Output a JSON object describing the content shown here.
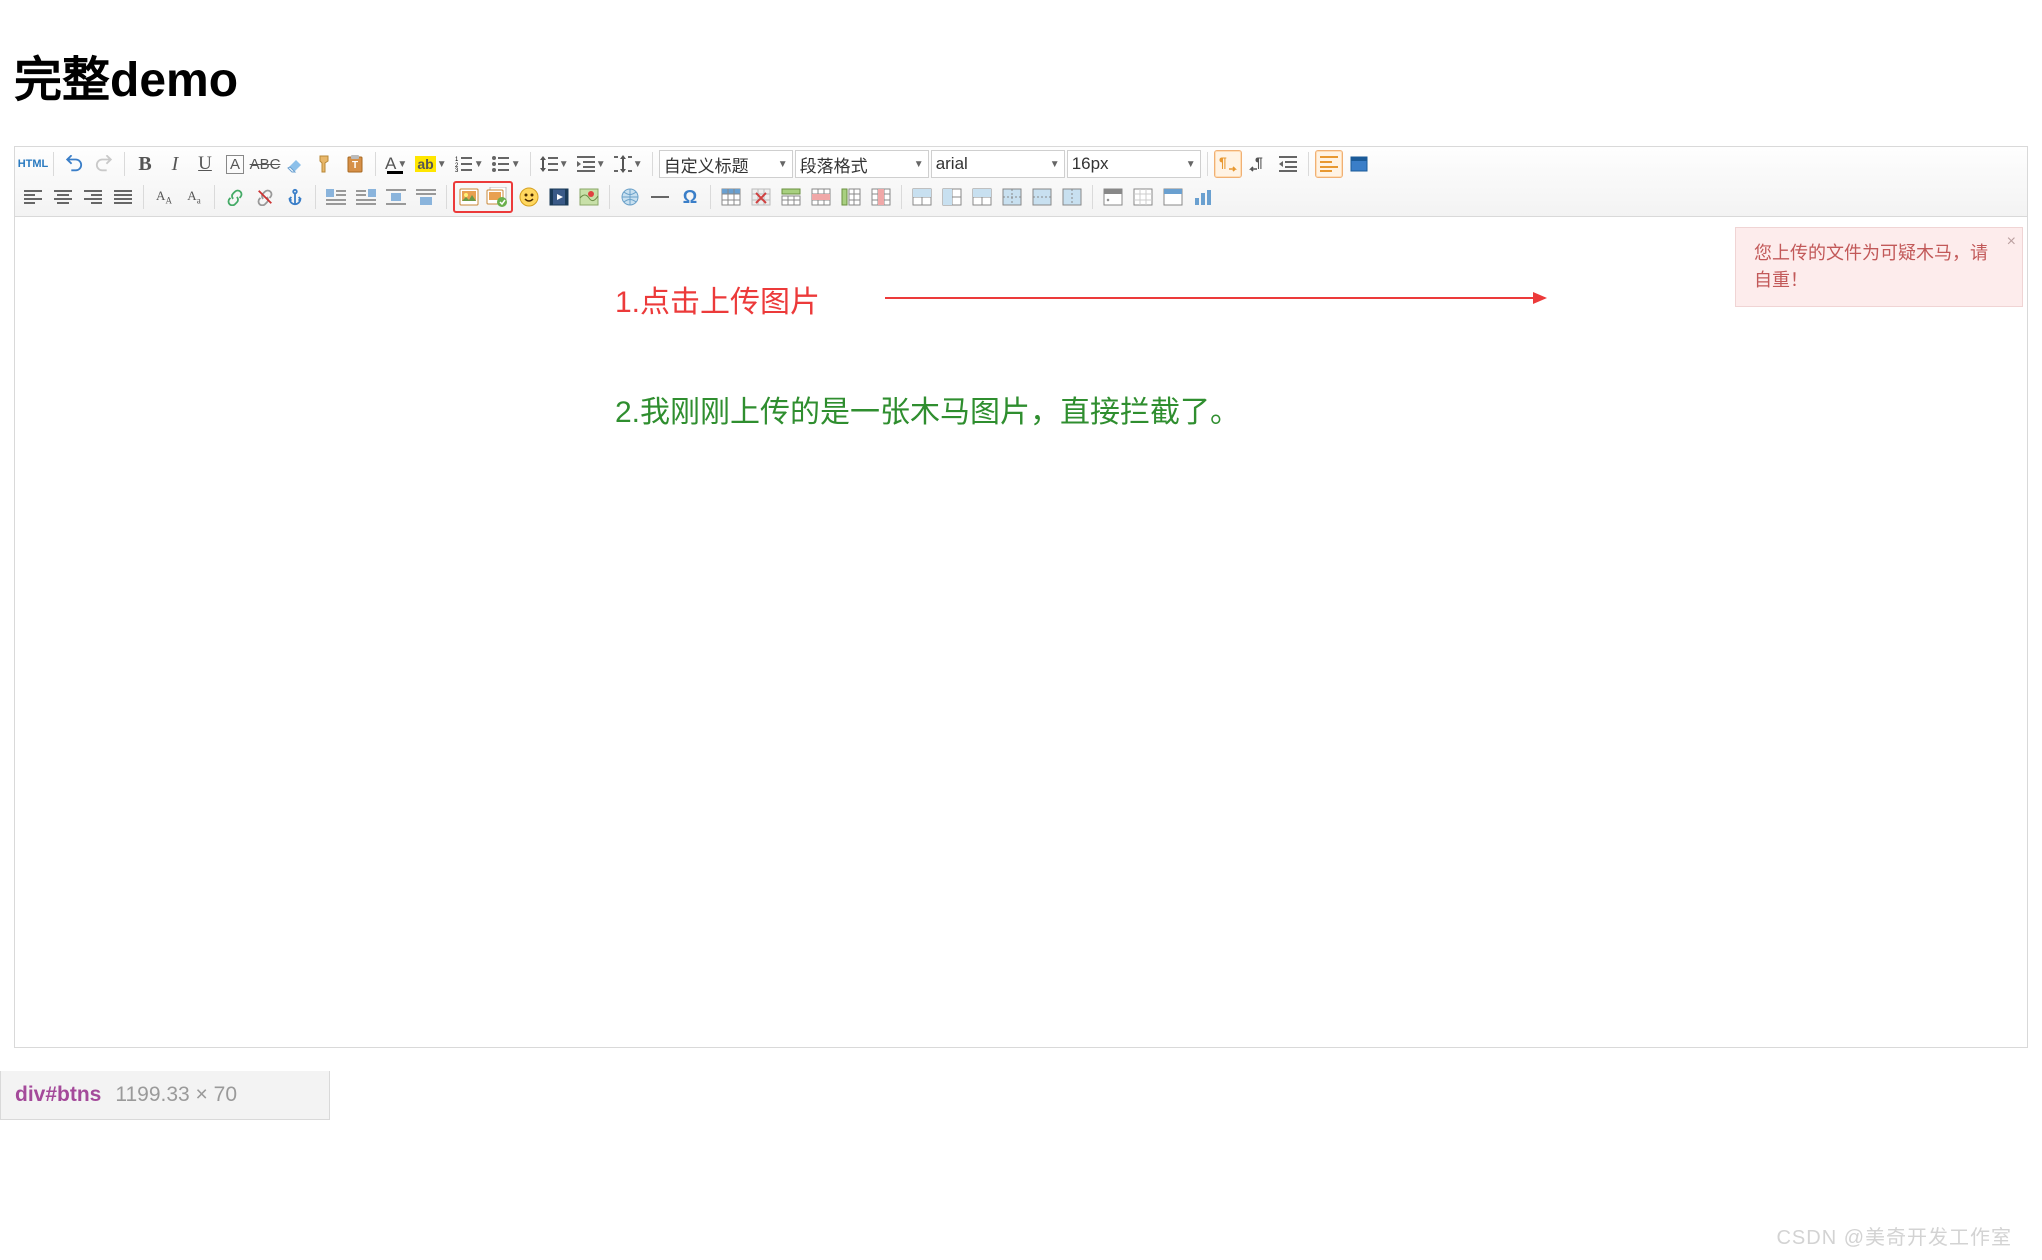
{
  "title": "完整demo",
  "toolbar": {
    "source_label": "HTML",
    "selects": {
      "custom_title": "自定义标题",
      "paragraph": "段落格式",
      "font_family": "arial",
      "font_size": "16px"
    }
  },
  "annotations": {
    "step1": "1.点击上传图片",
    "step2": "2.我刚刚上传的是一张木马图片，直接拦截了。"
  },
  "alert": {
    "text": "您上传的文件为可疑木马，请自重！",
    "close": "×"
  },
  "statusbar": {
    "tag": "div#btns",
    "dim": "1199.33 × 70"
  },
  "watermark": "CSDN @美奇开发工作室"
}
